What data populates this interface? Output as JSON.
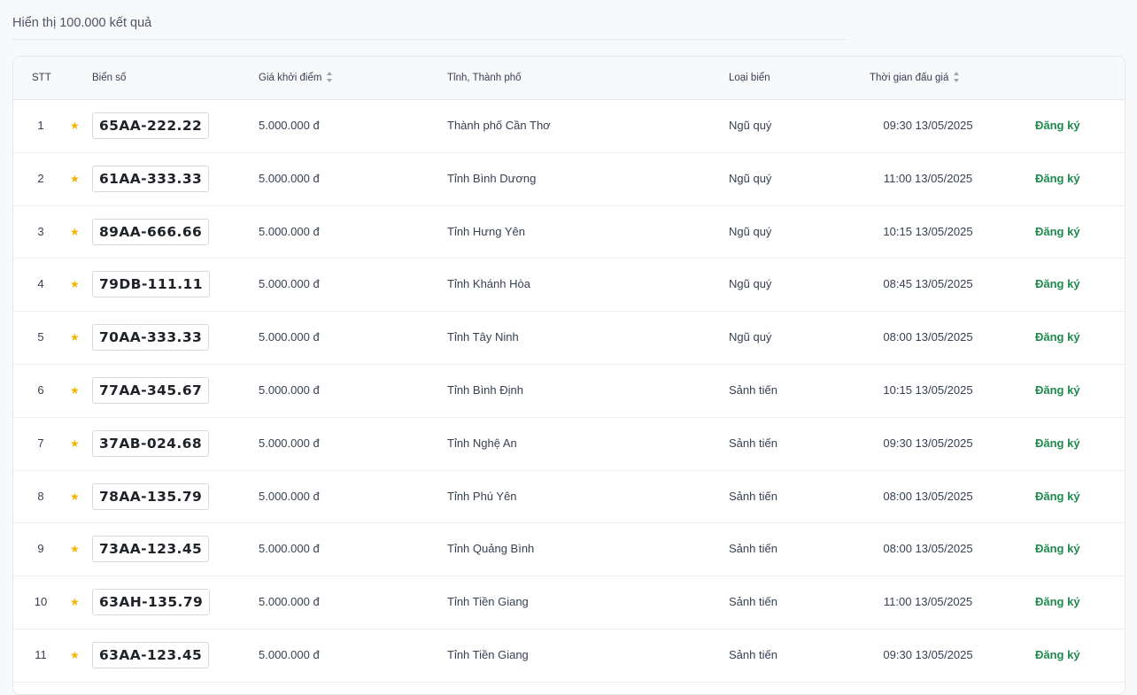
{
  "result_count_text": "Hiển thị 100.000 kết quả",
  "table": {
    "headers": {
      "stt": "STT",
      "plate": "Biển số",
      "price": "Giá khởi điểm",
      "province": "Tỉnh, Thành phố",
      "type": "Loại biển",
      "time": "Thời gian đấu giá"
    },
    "rows": [
      {
        "stt": "1",
        "plate": "65AA-222.22",
        "price": "5.000.000 đ",
        "province": "Thành phố Cần Thơ",
        "type": "Ngũ quý",
        "time": "09:30 13/05/2025",
        "action": "Đăng ký"
      },
      {
        "stt": "2",
        "plate": "61AA-333.33",
        "price": "5.000.000 đ",
        "province": "Tỉnh Bình Dương",
        "type": "Ngũ quý",
        "time": "11:00 13/05/2025",
        "action": "Đăng ký"
      },
      {
        "stt": "3",
        "plate": "89AA-666.66",
        "price": "5.000.000 đ",
        "province": "Tỉnh Hưng Yên",
        "type": "Ngũ quý",
        "time": "10:15 13/05/2025",
        "action": "Đăng ký"
      },
      {
        "stt": "4",
        "plate": "79DB-111.11",
        "price": "5.000.000 đ",
        "province": "Tỉnh Khánh Hòa",
        "type": "Ngũ quý",
        "time": "08:45 13/05/2025",
        "action": "Đăng ký"
      },
      {
        "stt": "5",
        "plate": "70AA-333.33",
        "price": "5.000.000 đ",
        "province": "Tỉnh Tây Ninh",
        "type": "Ngũ quý",
        "time": "08:00 13/05/2025",
        "action": "Đăng ký"
      },
      {
        "stt": "6",
        "plate": "77AA-345.67",
        "price": "5.000.000 đ",
        "province": "Tỉnh Bình Định",
        "type": "Sảnh tiến",
        "time": "10:15 13/05/2025",
        "action": "Đăng ký"
      },
      {
        "stt": "7",
        "plate": "37AB-024.68",
        "price": "5.000.000 đ",
        "province": "Tỉnh Nghệ An",
        "type": "Sảnh tiến",
        "time": "09:30 13/05/2025",
        "action": "Đăng ký"
      },
      {
        "stt": "8",
        "plate": "78AA-135.79",
        "price": "5.000.000 đ",
        "province": "Tỉnh Phú Yên",
        "type": "Sảnh tiến",
        "time": "08:00 13/05/2025",
        "action": "Đăng ký"
      },
      {
        "stt": "9",
        "plate": "73AA-123.45",
        "price": "5.000.000 đ",
        "province": "Tỉnh Quảng Bình",
        "type": "Sảnh tiến",
        "time": "08:00 13/05/2025",
        "action": "Đăng ký"
      },
      {
        "stt": "10",
        "plate": "63AH-135.79",
        "price": "5.000.000 đ",
        "province": "Tỉnh Tiền Giang",
        "type": "Sảnh tiến",
        "time": "11:00 13/05/2025",
        "action": "Đăng ký"
      },
      {
        "stt": "11",
        "plate": "63AA-123.45",
        "price": "5.000.000 đ",
        "province": "Tỉnh Tiền Giang",
        "type": "Sảnh tiến",
        "time": "09:30 13/05/2025",
        "action": "Đăng ký"
      }
    ]
  },
  "colors": {
    "star": "#f5b301",
    "action": "#1e8a4c"
  },
  "icons": {
    "favorite": "star-icon",
    "sort": "sort-icon"
  }
}
